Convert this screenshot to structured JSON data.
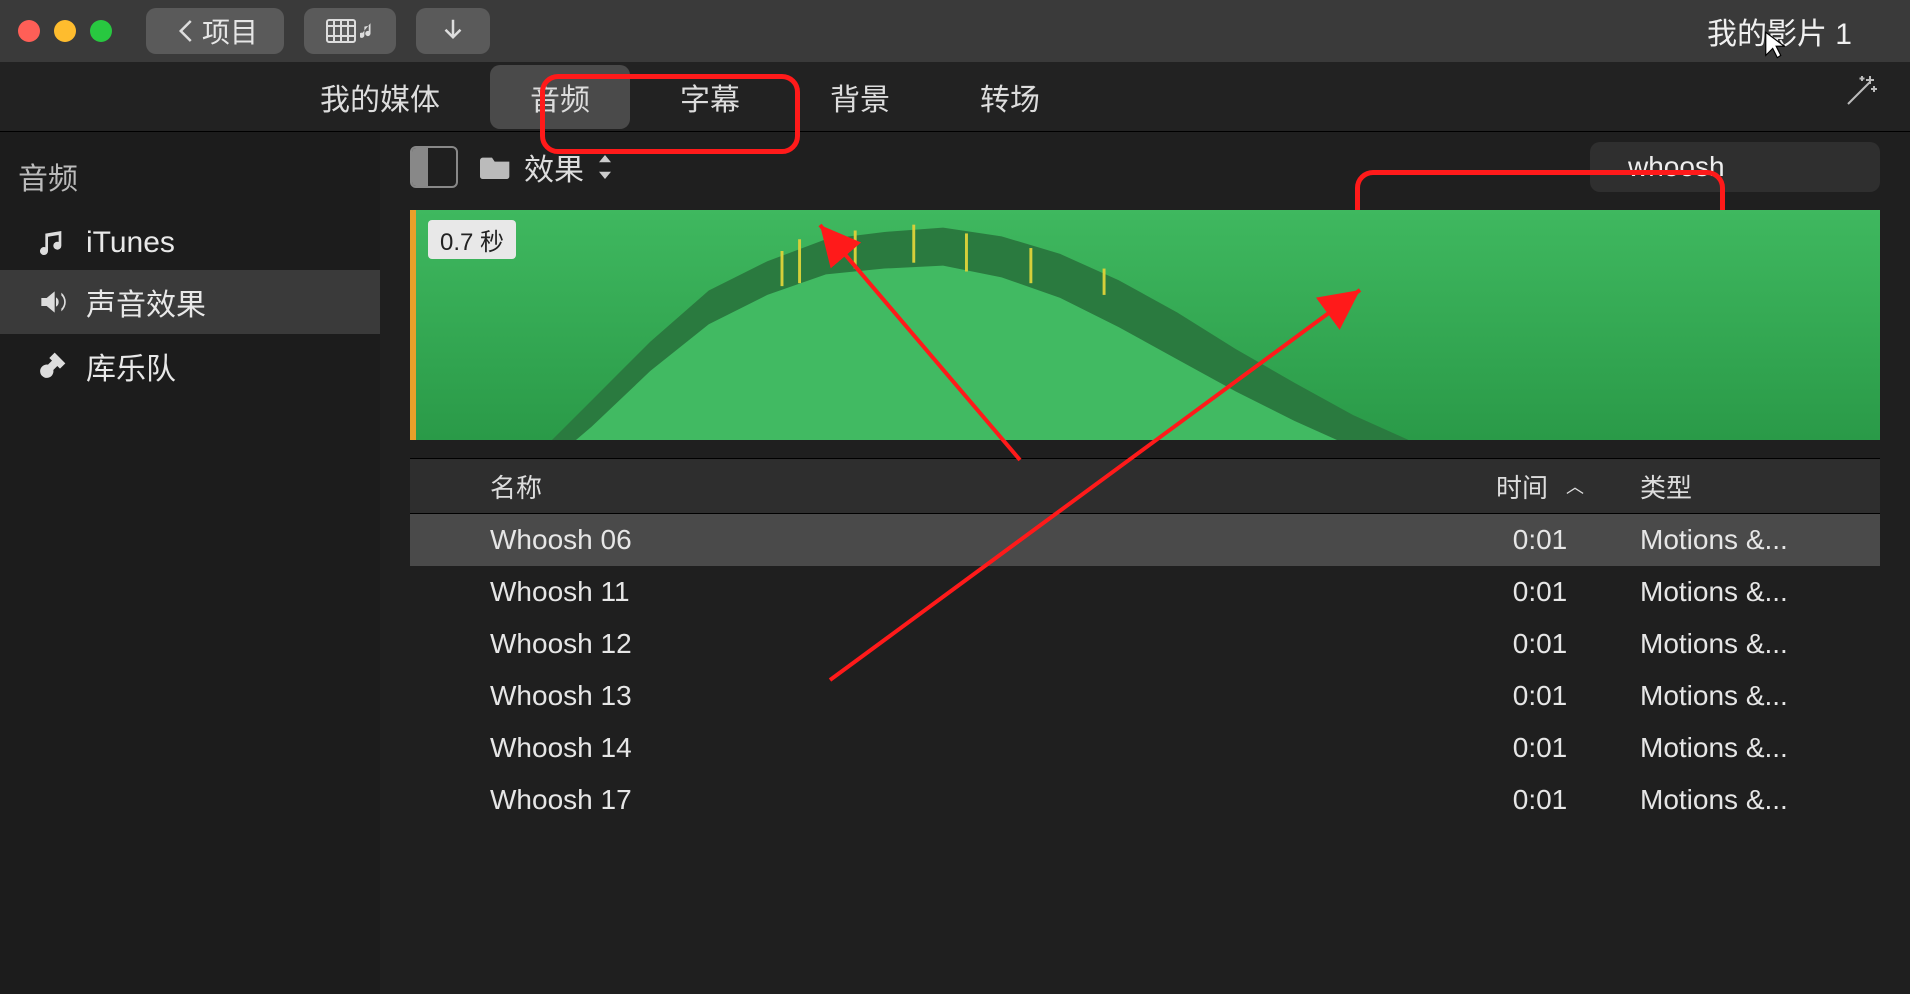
{
  "titlebar": {
    "back_label": "项目",
    "project_title": "我的影片 1"
  },
  "tabs": {
    "my_media": "我的媒体",
    "audio": "音频",
    "titles": "字幕",
    "backgrounds": "背景",
    "transitions": "转场"
  },
  "sidebar": {
    "header": "音频",
    "items": [
      {
        "label": "iTunes",
        "icon": "music-note"
      },
      {
        "label": "声音效果",
        "icon": "speaker"
      },
      {
        "label": "库乐队",
        "icon": "guitar"
      }
    ]
  },
  "browser": {
    "folder_label": "效果",
    "search_value": "whoosh",
    "waveform_duration": "0.7 秒"
  },
  "table": {
    "headers": {
      "name": "名称",
      "time": "时间",
      "type": "类型"
    },
    "rows": [
      {
        "name": "Whoosh 06",
        "time": "0:01",
        "type": "Motions &...",
        "selected": true
      },
      {
        "name": "Whoosh 11",
        "time": "0:01",
        "type": "Motions &...",
        "selected": false
      },
      {
        "name": "Whoosh 12",
        "time": "0:01",
        "type": "Motions &...",
        "selected": false
      },
      {
        "name": "Whoosh 13",
        "time": "0:01",
        "type": "Motions &...",
        "selected": false
      },
      {
        "name": "Whoosh 14",
        "time": "0:01",
        "type": "Motions &...",
        "selected": false
      },
      {
        "name": "Whoosh 17",
        "time": "0:01",
        "type": "Motions &...",
        "selected": false
      }
    ]
  }
}
